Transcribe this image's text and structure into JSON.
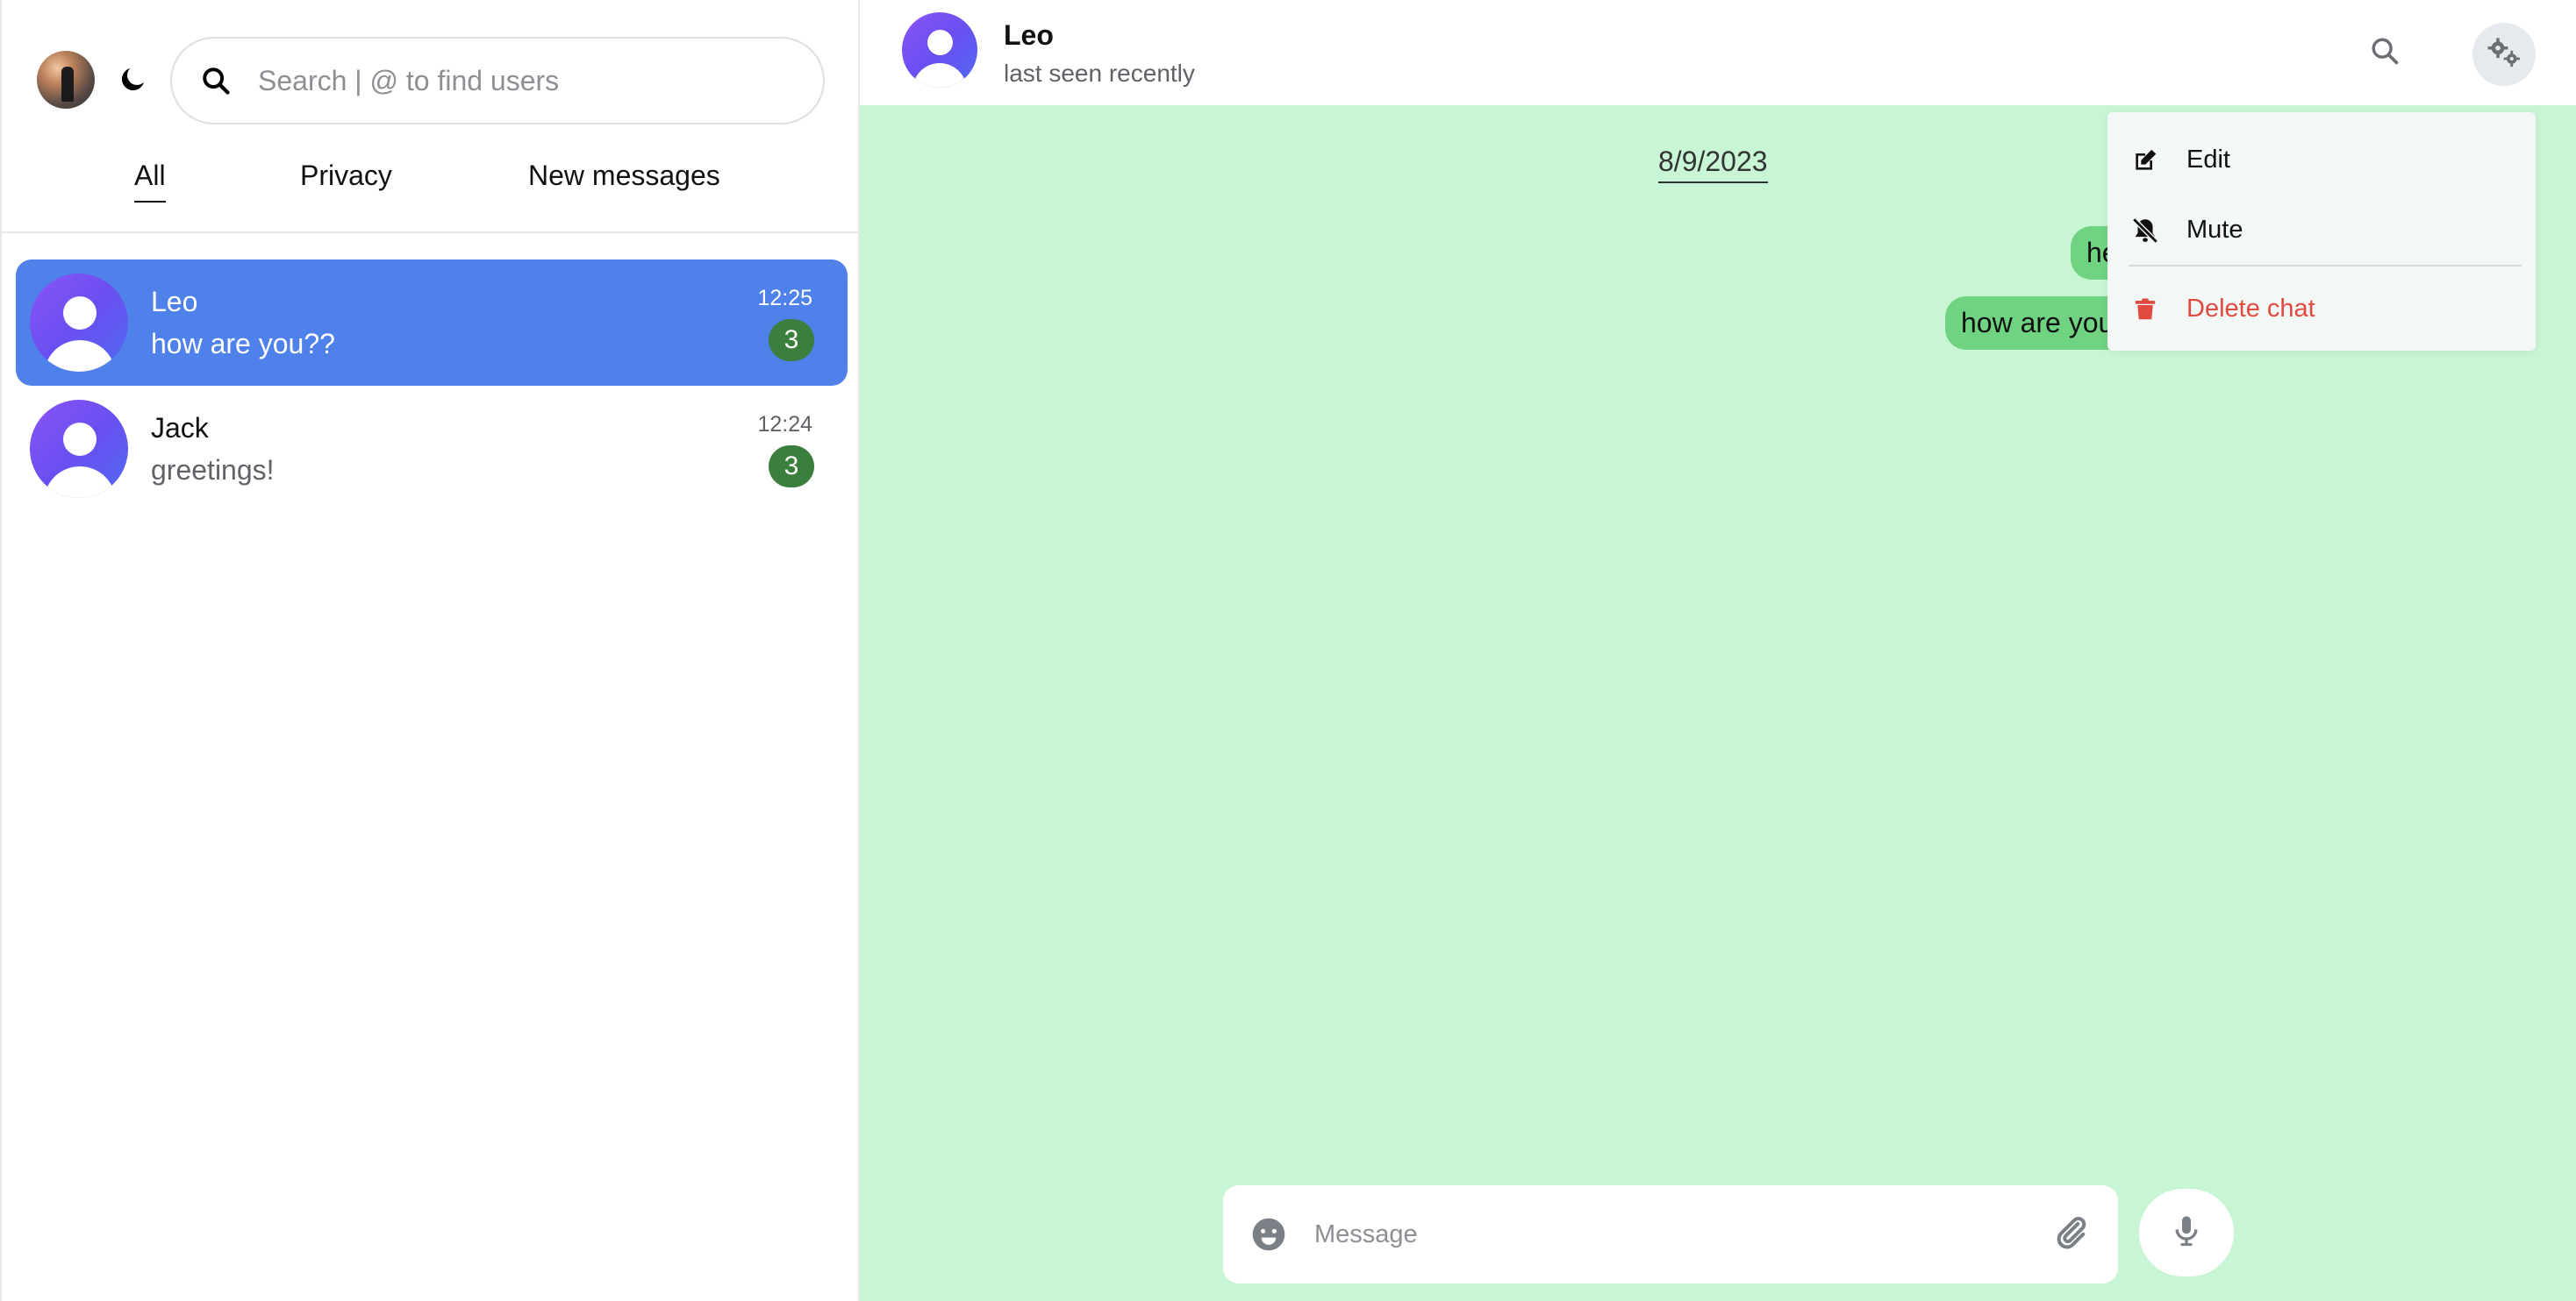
{
  "sidebar": {
    "profile_avatar": "profile-photo",
    "theme_icon": "moon-icon",
    "search": {
      "placeholder": "Search | @ to find users",
      "value": ""
    },
    "tabs": [
      {
        "label": "All",
        "active": true
      },
      {
        "label": "Privacy",
        "active": false
      },
      {
        "label": "New messages",
        "active": false
      }
    ],
    "chats": [
      {
        "name": "Leo",
        "preview": "how are you??",
        "time": "12:25",
        "unread": "3",
        "active": true
      },
      {
        "name": "Jack",
        "preview": "greetings!",
        "time": "12:24",
        "unread": "3",
        "active": false
      }
    ]
  },
  "header": {
    "title": "Leo",
    "subtitle": "last seen recently",
    "search_icon": "search-icon",
    "settings_icon": "gears-icon"
  },
  "conversation": {
    "date": "8/9/2023",
    "messages": [
      {
        "text": "hello",
        "direction": "outgoing"
      },
      {
        "text": "how are you??",
        "direction": "outgoing"
      }
    ]
  },
  "menu": {
    "items": [
      {
        "label": "Edit",
        "icon": "edit-icon"
      },
      {
        "label": "Mute",
        "icon": "bell-slash-icon"
      },
      {
        "label": "Delete chat",
        "icon": "trash-icon",
        "color": "#e04a3f"
      }
    ]
  },
  "composer": {
    "placeholder": "Message",
    "value": ""
  },
  "colors": {
    "accent": "#4f81ea",
    "chat_background": "#c8f5d4",
    "bubble": "#6fd382",
    "badge": "#3b7f3f",
    "danger": "#e04a3f"
  }
}
